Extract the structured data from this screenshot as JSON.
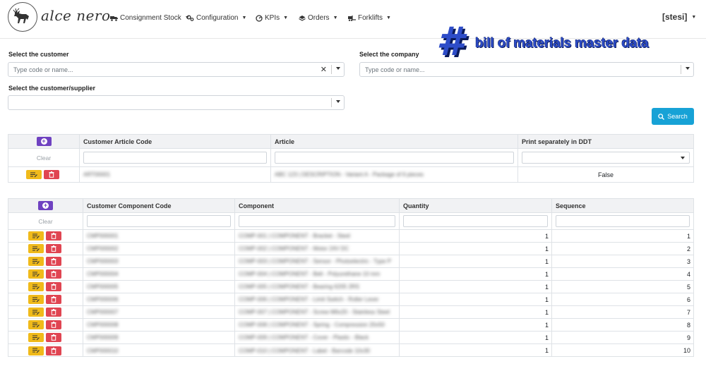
{
  "app": {
    "logo_text": "alce nero",
    "user": "[stesi]"
  },
  "nav": [
    {
      "label": "Consignment Stock",
      "icon": "truck-loading-icon"
    },
    {
      "label": "Configuration",
      "icon": "cogs-icon"
    },
    {
      "label": "KPIs",
      "icon": "gauge-icon"
    },
    {
      "label": "Orders",
      "icon": "layers-icon"
    },
    {
      "label": "Forklifts",
      "icon": "forklift-icon"
    }
  ],
  "overlay": {
    "hash": "#",
    "text": "bill of materials master data"
  },
  "form": {
    "customer_label": "Select the customer",
    "customer_placeholder": "Type code or name...",
    "company_label": "Select the company",
    "company_placeholder": "Type code or name...",
    "supplier_label": "Select the customer/supplier",
    "search_label": "Search"
  },
  "articles": {
    "headers": [
      "Customer Article Code",
      "Article",
      "Print separately in DDT"
    ],
    "clear_label": "Clear",
    "rows": [
      {
        "code": "ART00001",
        "article": "ABC 123 | DESCRIPTION - Variant A - Package of 6 pieces",
        "print": "False"
      }
    ]
  },
  "components": {
    "headers": [
      "Customer Component Code",
      "Component",
      "Quantity",
      "Sequence"
    ],
    "clear_label": "Clear",
    "rows": [
      {
        "code": "CMP000001",
        "component": "COMP-001 | COMPONENT - Bracket - Steel",
        "qty": "1",
        "seq": "1"
      },
      {
        "code": "CMP000002",
        "component": "COMP-002 | COMPONENT - Motor 24V DC",
        "qty": "1",
        "seq": "2"
      },
      {
        "code": "CMP000003",
        "component": "COMP-003 | COMPONENT - Sensor - Photoelectric - Type P",
        "qty": "1",
        "seq": "3"
      },
      {
        "code": "CMP000004",
        "component": "COMP-004 | COMPONENT - Belt - Polyurethane 10 mm",
        "qty": "1",
        "seq": "4"
      },
      {
        "code": "CMP000005",
        "component": "COMP-005 | COMPONENT - Bearing 6205 2RS",
        "qty": "1",
        "seq": "5"
      },
      {
        "code": "CMP000006",
        "component": "COMP-006 | COMPONENT - Limit Switch - Roller Lever",
        "qty": "1",
        "seq": "6"
      },
      {
        "code": "CMP000007",
        "component": "COMP-007 | COMPONENT - Screw M6x20 - Stainless Steel",
        "qty": "1",
        "seq": "7"
      },
      {
        "code": "CMP000008",
        "component": "COMP-008 | COMPONENT - Spring - Compression 20x50",
        "qty": "1",
        "seq": "8"
      },
      {
        "code": "CMP000009",
        "component": "COMP-009 | COMPONENT - Cover - Plastic - Black",
        "qty": "1",
        "seq": "9"
      },
      {
        "code": "CMP000010",
        "component": "COMP-010 | COMPONENT - Label - Barcode 10x30",
        "qty": "1",
        "seq": "10"
      }
    ]
  }
}
